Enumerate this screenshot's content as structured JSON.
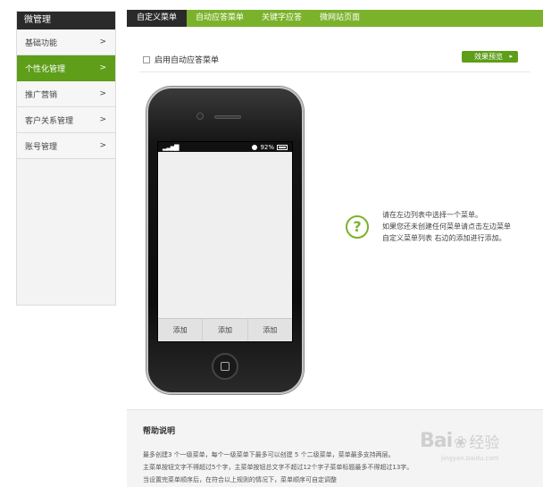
{
  "sidebar": {
    "title": "微管理",
    "items": [
      {
        "label": "基础功能",
        "chevron": ">",
        "active": false
      },
      {
        "label": "个性化管理",
        "chevron": ">",
        "active": true
      },
      {
        "label": "推广营销",
        "chevron": ">",
        "active": false
      },
      {
        "label": "客户关系管理",
        "chevron": ">",
        "active": false
      },
      {
        "label": "账号管理",
        "chevron": ">",
        "active": false
      }
    ]
  },
  "tabs": [
    {
      "label": "自定义菜单",
      "active": true
    },
    {
      "label": "自动应答菜单",
      "active": false
    },
    {
      "label": "关键字应答",
      "active": false
    },
    {
      "label": "微网站页面",
      "active": false
    }
  ],
  "main": {
    "enable_checkbox_label": "启用自动应答菜单",
    "effect_button_label": "效果预览",
    "effect_button_arrow": "▸"
  },
  "phone": {
    "battery_text": "92%",
    "signal_glyph": "▂▃▅▇",
    "menu_buttons": [
      "添加",
      "添加",
      "添加"
    ]
  },
  "hint": {
    "icon_glyph": "?",
    "lines": [
      "请在左边列表中选择一个菜单。",
      "如果您还未创建任何菜单请点击左边菜单",
      "自定义菜单列表 右边的添加进行添加。"
    ]
  },
  "help": {
    "title": "帮助说明",
    "lines": [
      "最多创建3 个一级菜单，每个一级菜单下最多可以创建 5 个二级菜单，菜单最多支持两层。",
      "主菜单按钮文字不得超过5个字，主菜单按钮总文字不超过12个字子菜单标题最多不得超过13字。",
      "当设置完菜单顺序后，在符合以上规则的情况下，菜单顺序可自定调整"
    ]
  },
  "watermark": {
    "brand": "Bai",
    "paw": "❀",
    "brand_suffix": "经验",
    "url": "jingyan.baidu.com"
  },
  "colors": {
    "accent_green": "#7bb22b",
    "active_green": "#5e9e18",
    "dark_header": "#2a2a2a"
  }
}
